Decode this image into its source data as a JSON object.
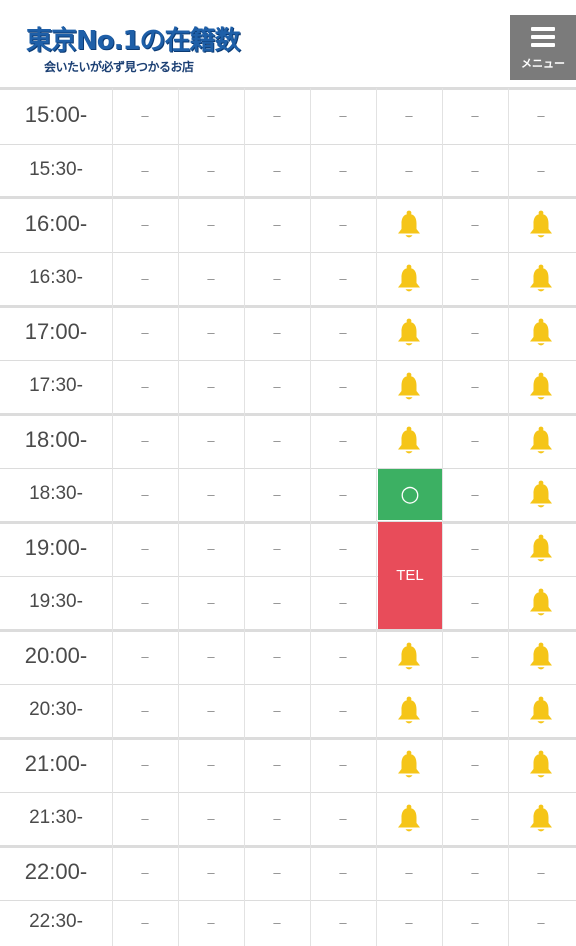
{
  "header": {
    "logo_title": "東京No.1の在籍数",
    "logo_tagline": "会いたいが必ず見つかるお店",
    "menu_label": "メニュー"
  },
  "colors": {
    "available": "#3cb063",
    "tel": "#e84c5a",
    "bell": "#f5c518",
    "menu_bg": "#7b7b7b"
  },
  "schedule": {
    "rows": [
      {
        "time": "15:00-",
        "cells": [
          "–",
          "–",
          "–",
          "–",
          "–",
          "–",
          "–"
        ]
      },
      {
        "time": "15:30-",
        "cells": [
          "–",
          "–",
          "–",
          "–",
          "–",
          "–",
          "–"
        ]
      },
      {
        "time": "16:00-",
        "cells": [
          "–",
          "–",
          "–",
          "–",
          "bell",
          "–",
          "bell"
        ]
      },
      {
        "time": "16:30-",
        "cells": [
          "–",
          "–",
          "–",
          "–",
          "bell",
          "–",
          "bell"
        ]
      },
      {
        "time": "17:00-",
        "cells": [
          "–",
          "–",
          "–",
          "–",
          "bell",
          "–",
          "bell"
        ]
      },
      {
        "time": "17:30-",
        "cells": [
          "–",
          "–",
          "–",
          "–",
          "bell",
          "–",
          "bell"
        ]
      },
      {
        "time": "18:00-",
        "cells": [
          "–",
          "–",
          "–",
          "–",
          "bell",
          "–",
          "bell"
        ]
      },
      {
        "time": "18:30-",
        "cells": [
          "–",
          "–",
          "–",
          "–",
          "ok",
          "–",
          "bell"
        ]
      },
      {
        "time": "19:00-",
        "cells": [
          "–",
          "–",
          "–",
          "–",
          "tel",
          "–",
          "bell"
        ]
      },
      {
        "time": "19:30-",
        "cells": [
          "–",
          "–",
          "–",
          "–",
          "tel",
          "–",
          "bell"
        ]
      },
      {
        "time": "20:00-",
        "cells": [
          "–",
          "–",
          "–",
          "–",
          "bell",
          "–",
          "bell"
        ]
      },
      {
        "time": "20:30-",
        "cells": [
          "–",
          "–",
          "–",
          "–",
          "bell",
          "–",
          "bell"
        ]
      },
      {
        "time": "21:00-",
        "cells": [
          "–",
          "–",
          "–",
          "–",
          "bell",
          "–",
          "bell"
        ]
      },
      {
        "time": "21:30-",
        "cells": [
          "–",
          "–",
          "–",
          "–",
          "bell",
          "–",
          "bell"
        ]
      },
      {
        "time": "22:00-",
        "cells": [
          "–",
          "–",
          "–",
          "–",
          "–",
          "–",
          "–"
        ]
      },
      {
        "time": "22:30-",
        "cells": [
          "–",
          "–",
          "–",
          "–",
          "–",
          "–",
          "–"
        ]
      }
    ],
    "ok_symbol": "○",
    "tel_label": "TEL",
    "dash_symbol": "–",
    "bell_icon": "bell-icon"
  }
}
